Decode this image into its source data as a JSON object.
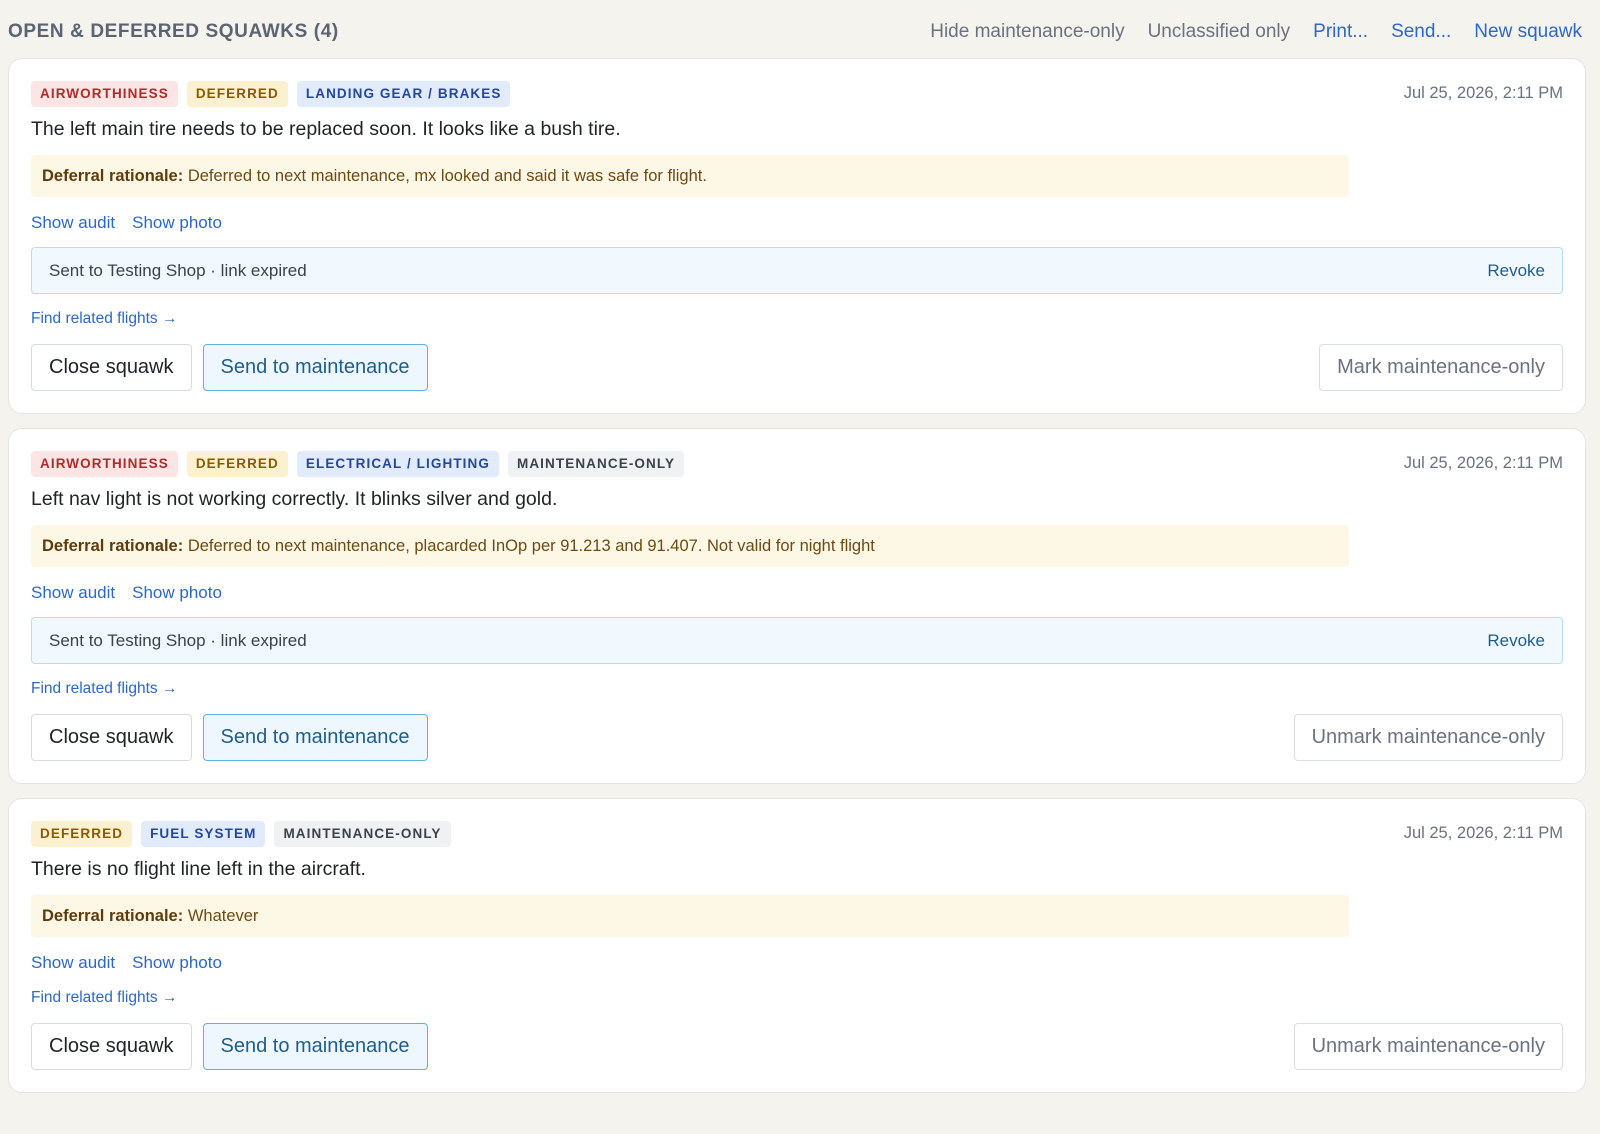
{
  "header": {
    "title": "OPEN & DEFERRED SQUAWKS (4)",
    "links": [
      {
        "label": "Hide maintenance-only",
        "style": "muted"
      },
      {
        "label": "Unclassified only",
        "style": "muted"
      },
      {
        "label": "Print...",
        "style": "blue"
      },
      {
        "label": "Send...",
        "style": "blue"
      },
      {
        "label": "New squawk",
        "style": "blue"
      }
    ]
  },
  "labels": {
    "show_audit": "Show audit",
    "show_photo": "Show photo",
    "find_related": "Find related flights →",
    "revoke": "Revoke",
    "close_squawk": "Close squawk",
    "send_to_maintenance": "Send to maintenance",
    "rationale_label": "Deferral rationale:"
  },
  "squawks": [
    {
      "chips": [
        {
          "label": "AIRWORTHINESS",
          "kind": "air"
        },
        {
          "label": "DEFERRED",
          "kind": "def"
        },
        {
          "label": "LANDING GEAR / BRAKES",
          "kind": "cat"
        }
      ],
      "timestamp": "Jul 25, 2026, 2:11 PM",
      "description": "The left main tire needs to be replaced soon. It looks like a bush tire.",
      "rationale": "Deferred to next maintenance, mx looked and said it was safe for flight.",
      "sent_status": "Sent to Testing Shop · link expired",
      "mx_toggle_label": "Mark maintenance-only"
    },
    {
      "chips": [
        {
          "label": "AIRWORTHINESS",
          "kind": "air"
        },
        {
          "label": "DEFERRED",
          "kind": "def"
        },
        {
          "label": "ELECTRICAL / LIGHTING",
          "kind": "cat"
        },
        {
          "label": "MAINTENANCE-ONLY",
          "kind": "mxo"
        }
      ],
      "timestamp": "Jul 25, 2026, 2:11 PM",
      "description": "Left nav light is not working correctly. It blinks silver and gold.",
      "rationale": "Deferred to next maintenance, placarded InOp per 91.213 and 91.407. Not valid for night flight",
      "sent_status": "Sent to Testing Shop · link expired",
      "mx_toggle_label": "Unmark maintenance-only"
    },
    {
      "chips": [
        {
          "label": "DEFERRED",
          "kind": "def"
        },
        {
          "label": "FUEL SYSTEM",
          "kind": "cat"
        },
        {
          "label": "MAINTENANCE-ONLY",
          "kind": "mxo"
        }
      ],
      "timestamp": "Jul 25, 2026, 2:11 PM",
      "description": "There is no flight line left in the aircraft.",
      "rationale": "Whatever",
      "sent_status": "",
      "mx_toggle_label": "Unmark maintenance-only"
    }
  ]
}
